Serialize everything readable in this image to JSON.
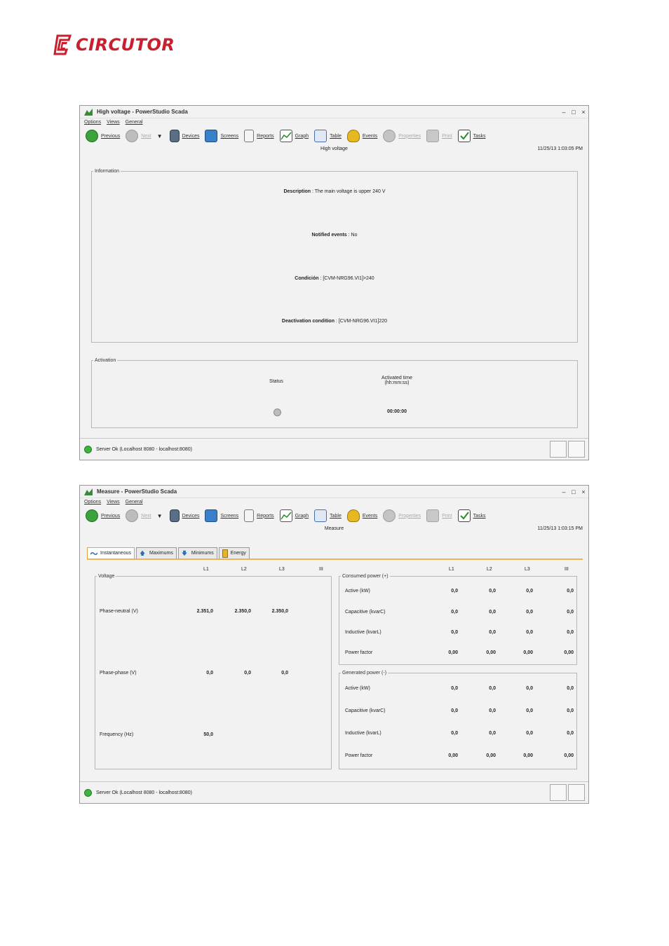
{
  "logo": {
    "text": "CIRCUTOR"
  },
  "win1": {
    "title": "High voltage - PowerStudio Scada",
    "menu": [
      "Options",
      "Views",
      "General"
    ],
    "toolbar": {
      "previous": "Previous",
      "next": "Next",
      "devices": "Devices",
      "screens": "Screens",
      "reports": "Reports",
      "graph": "Graph",
      "table": "Table",
      "events": "Events",
      "properties": "Properties",
      "print": "Print",
      "tasks": "Tasks"
    },
    "heading": "High voltage",
    "datetime": "11/25/13 1:03:05 PM",
    "information": {
      "legend": "Information",
      "description_label": "Description",
      "description_value": " : The main voltage is upper 240 V",
      "notified_label": "Notified events",
      "notified_value": " : No",
      "condition_label": "Condición",
      "condition_value": " : [CVM-NRG96.VI1]>240",
      "deactivation_label": "Deactivation condition",
      "deactivation_value": " : [CVM-NRG96.VI1]220"
    },
    "activation": {
      "legend": "Activation",
      "status_label": "Status",
      "time_label_1": "Activated time",
      "time_label_2": "(hh:mm:ss)",
      "time_value": "00:00:00"
    },
    "status": "Server Ok (Localhost 8080 - localhost:8080)"
  },
  "win2": {
    "title": "Measure - PowerStudio Scada",
    "menu": [
      "Options",
      "Views",
      "General"
    ],
    "toolbar": {
      "previous": "Previous",
      "next": "Next",
      "devices": "Devices",
      "screens": "Screens",
      "reports": "Reports",
      "graph": "Graph",
      "table": "Table",
      "events": "Events",
      "properties": "Properties",
      "print": "Print",
      "tasks": "Tasks"
    },
    "heading": "Measure",
    "datetime": "11/25/13 1:03:15 PM",
    "tabs": [
      "Instantaneous",
      "Maximums",
      "Minimums",
      "Energy"
    ],
    "cols": [
      "L1",
      "L2",
      "L3",
      "III"
    ],
    "voltage": {
      "legend": "Voltage",
      "rows": [
        {
          "label": "Phase-neutral (V)",
          "values": [
            "2.351,0",
            "2.350,0",
            "2.350,0"
          ]
        },
        {
          "label": "Phase-phase (V)",
          "values": [
            "0,0",
            "0,0",
            "0,0"
          ]
        },
        {
          "label": "Frequency (Hz)",
          "values": [
            "50,0"
          ]
        }
      ]
    },
    "consumed": {
      "legend": "Consumed power (+)",
      "rows": [
        {
          "label": "Active (kW)",
          "values": [
            "0,0",
            "0,0",
            "0,0",
            "0,0"
          ]
        },
        {
          "label": "Capacitive (kvarC)",
          "values": [
            "0,0",
            "0,0",
            "0,0",
            "0,0"
          ]
        },
        {
          "label": "Inductive (kvarL)",
          "values": [
            "0,0",
            "0,0",
            "0,0",
            "0,0"
          ]
        },
        {
          "label": "Power factor",
          "values": [
            "0,00",
            "0,00",
            "0,00",
            "0,00"
          ]
        }
      ]
    },
    "generated": {
      "legend": "Generated power (-)",
      "rows": [
        {
          "label": "Active (kW)",
          "values": [
            "0,0",
            "0,0",
            "0,0",
            "0,0"
          ]
        },
        {
          "label": "Capacitive (kvarC)",
          "values": [
            "0,0",
            "0,0",
            "0,0",
            "0,0"
          ]
        },
        {
          "label": "Inductive (kvarL)",
          "values": [
            "0,0",
            "0,0",
            "0,0",
            "0,0"
          ]
        },
        {
          "label": "Power factor",
          "values": [
            "0,00",
            "0,00",
            "0,00",
            "0,00"
          ]
        }
      ]
    },
    "status": "Server Ok (Localhost 8080 - localhost:8080)"
  },
  "colors": {
    "brand": "#c8202e",
    "tab_accent": "#e9b45a",
    "status_ok": "#3db43d"
  }
}
